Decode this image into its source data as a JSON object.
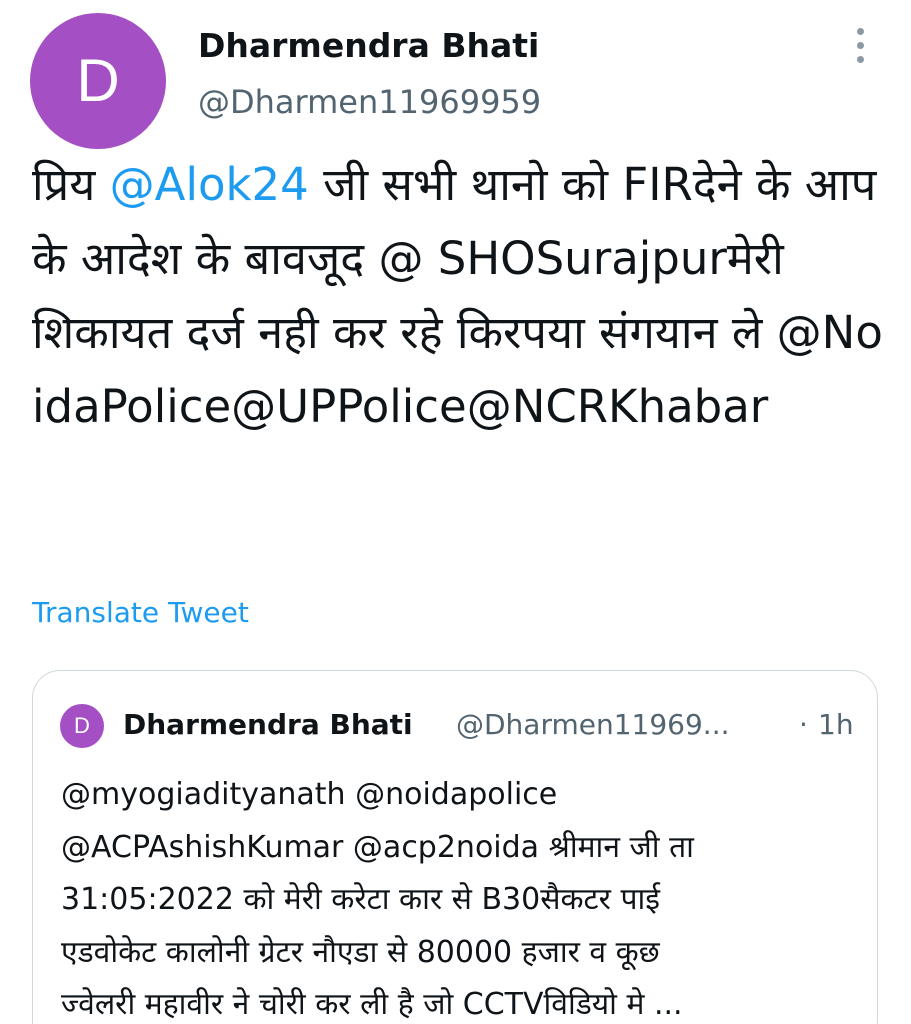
{
  "tweet": {
    "author": {
      "avatar_initial": "D",
      "name": "Dharmendra Bhati",
      "handle": "@Dharmen11969959"
    },
    "more_icon": "more-vertical-icon",
    "text_segments": {
      "s1": "प्रिय ",
      "s2": "@Alok24",
      "s3": " जी सभी थानो को FIRदेने के आपके आदेश के बावजूद @ SHOSurajpurमेरी शिकायत दर्ज नही कर रहे किरपया संगयान ले @NoidaPolice@UPPolice@NCRKhabar"
    },
    "translate_label": "Translate Tweet"
  },
  "quoted_tweet": {
    "avatar_initial": "D",
    "name": "Dharmendra Bhati",
    "handle": "@Dharmen11969...",
    "separator": "·",
    "time": "1h",
    "lines": [
      "@myogiadityanath @noidapolice",
      "@ACPAshishKumar @acp2noida श्रीमान जी ता",
      "31:05:2022 को मेरी करेटा कार से B30सैकटर पाई",
      "एडवोकेट  कालोनी ग्रेटर  नौएडा से 80000 हजार  व कूछ",
      "ज्वेलरी महावीर  ने चोरी कर ली है जो CCTVविडियो मे  ..."
    ]
  },
  "colors": {
    "avatar": "#a54fc4",
    "link": "#1d9bf0",
    "text": "#0f1419",
    "secondary": "#536471",
    "border": "#cfd9de"
  }
}
